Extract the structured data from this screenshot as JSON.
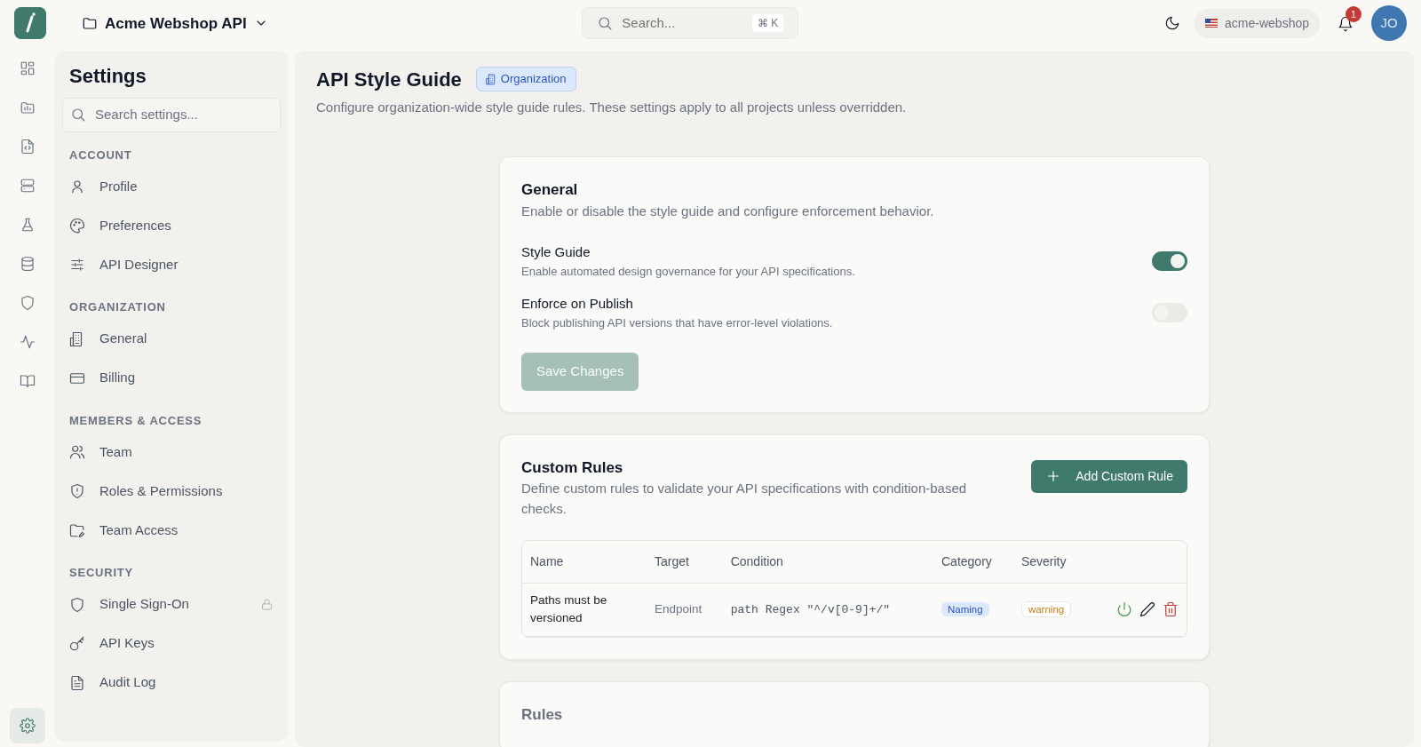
{
  "topbar": {
    "project": "Acme Webshop API",
    "search_placeholder": "Search...",
    "shortcut": "⌘ K",
    "workspace": "acme-webshop",
    "notification_count": "1",
    "avatar_initials": "JO"
  },
  "rail": [
    {
      "kind": "grid",
      "selected": false
    },
    {
      "kind": "chart",
      "selected": false
    },
    {
      "kind": "code",
      "selected": false
    },
    {
      "kind": "server",
      "selected": false
    },
    {
      "kind": "flask",
      "selected": false
    },
    {
      "kind": "database",
      "selected": false
    },
    {
      "kind": "shield",
      "selected": false
    },
    {
      "kind": "activity",
      "selected": false
    },
    {
      "kind": "book",
      "selected": false
    }
  ],
  "rail_footer": {
    "kind": "gear",
    "selected": true
  },
  "settings": {
    "title": "Settings",
    "search_placeholder": "Search settings...",
    "groups": [
      {
        "heading": "ACCOUNT",
        "items": [
          {
            "label": "Profile",
            "kind": "person",
            "locked": false
          },
          {
            "label": "Preferences",
            "kind": "palette",
            "locked": false
          },
          {
            "label": "API Designer",
            "kind": "sliders",
            "locked": false
          }
        ]
      },
      {
        "heading": "ORGANIZATION",
        "items": [
          {
            "label": "General",
            "kind": "building",
            "locked": false
          },
          {
            "label": "Billing",
            "kind": "card",
            "locked": false
          }
        ]
      },
      {
        "heading": "MEMBERS & ACCESS",
        "items": [
          {
            "label": "Team",
            "kind": "people",
            "locked": false
          },
          {
            "label": "Roles & Permissions",
            "kind": "alertshield",
            "locked": false
          },
          {
            "label": "Team Access",
            "kind": "folder",
            "locked": false
          }
        ]
      },
      {
        "heading": "SECURITY",
        "items": [
          {
            "label": "Single Sign-On",
            "kind": "shield",
            "locked": true
          },
          {
            "label": "API Keys",
            "kind": "key",
            "locked": false
          },
          {
            "label": "Audit Log",
            "kind": "document",
            "locked": false
          }
        ]
      }
    ]
  },
  "page": {
    "title": "API Style Guide",
    "badge": "Organization",
    "description": "Configure organization-wide style guide rules. These settings apply to all projects unless overridden."
  },
  "general": {
    "title": "General",
    "description": "Enable or disable the style guide and configure enforcement behavior.",
    "toggles": [
      {
        "label": "Style Guide",
        "description": "Enable automated design governance for your API specifications.",
        "on": true
      },
      {
        "label": "Enforce on Publish",
        "description": "Block publishing API versions that have error-level violations.",
        "on": false
      }
    ],
    "save": {
      "label": "Save Changes",
      "disabled": true
    }
  },
  "custom_rules": {
    "title": "Custom Rules",
    "description": "Define custom rules to validate your API specifications with condition-based checks.",
    "add_button": "Add Custom Rule",
    "columns": [
      "Name",
      "Target",
      "Condition",
      "Category",
      "Severity"
    ],
    "rows": [
      {
        "name": "Paths must be versioned",
        "target": "Endpoint",
        "condition": "path Regex \"^/v[0-9]+/\"",
        "category": "Naming",
        "severity": "warning",
        "enabled": true
      }
    ]
  },
  "rules": {
    "title": "Rules"
  }
}
